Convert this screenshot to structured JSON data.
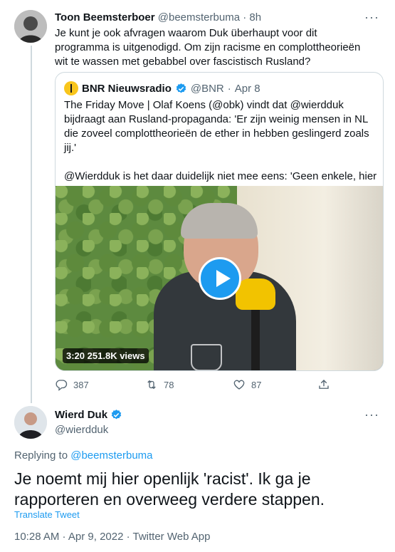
{
  "tweet1": {
    "name": "Toon Beemsterboer",
    "handle": "@beemsterbuma",
    "dot": "·",
    "time": "8h",
    "text": "Je kunt je ook afvragen waarom Duk überhaupt voor dit programma is uitgenodigd. Om zijn racisme en complottheorieën wit te wassen met gebabbel over fascistisch Rusland?",
    "more": "···"
  },
  "quoted": {
    "name": "BNR Nieuwsradio",
    "handle": "@BNR",
    "dot": "·",
    "date": "Apr 8",
    "text1": "The Friday Move | Olaf Koens (@obk) vindt dat @wierdduk bijdraagt aan Rusland-propaganda: 'Er zijn weinig mensen in NL die zoveel complottheorieën de ether in hebben geslingerd zoals jij.'",
    "text2": "@Wierdduk is het daar duidelijk niet mee eens: 'Geen enkele, hier vergis je je!'",
    "video_duration": "3:20",
    "video_views": "251.8K views"
  },
  "actions": {
    "replies": "387",
    "retweets": "78",
    "likes": "87"
  },
  "tweet2": {
    "name": "Wierd Duk",
    "handle": "@wierdduk",
    "more": "···",
    "replying_prefix": "Replying to ",
    "replying_to": "@beemsterbuma",
    "text": "Je noemt mij hier openlijk 'racist'. Ik ga je rapporteren en overweeg verdere stappen.",
    "translate": "Translate Tweet",
    "meta": "10:28 AM · Apr 9, 2022 · Twitter Web App"
  },
  "colors": {
    "accent": "#1d9bf0",
    "text": "#0f1419",
    "muted": "#536471",
    "border": "#cfd9de"
  }
}
